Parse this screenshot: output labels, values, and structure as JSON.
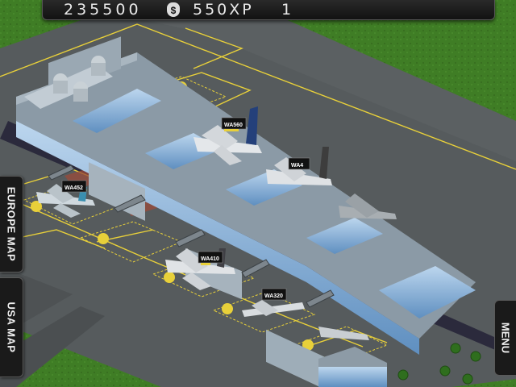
{
  "hud": {
    "money": "235500",
    "money_icon": "money-bag-icon",
    "money_icon_glyph": "$",
    "xp": "550XP",
    "level": "1"
  },
  "side_tabs": {
    "europe_map": "EUROPE MAP",
    "usa_map": "USA MAP",
    "menu": "MENU"
  },
  "flights": [
    {
      "callsign": "WA560"
    },
    {
      "callsign": "WA4"
    },
    {
      "callsign": "WA452"
    },
    {
      "callsign": "WA410"
    },
    {
      "callsign": "WA320"
    }
  ],
  "colors": {
    "grass": "#3f7d25",
    "tarmac": "#555b5d",
    "hud": "#1a1a1a",
    "marking": "#e8d03a"
  }
}
